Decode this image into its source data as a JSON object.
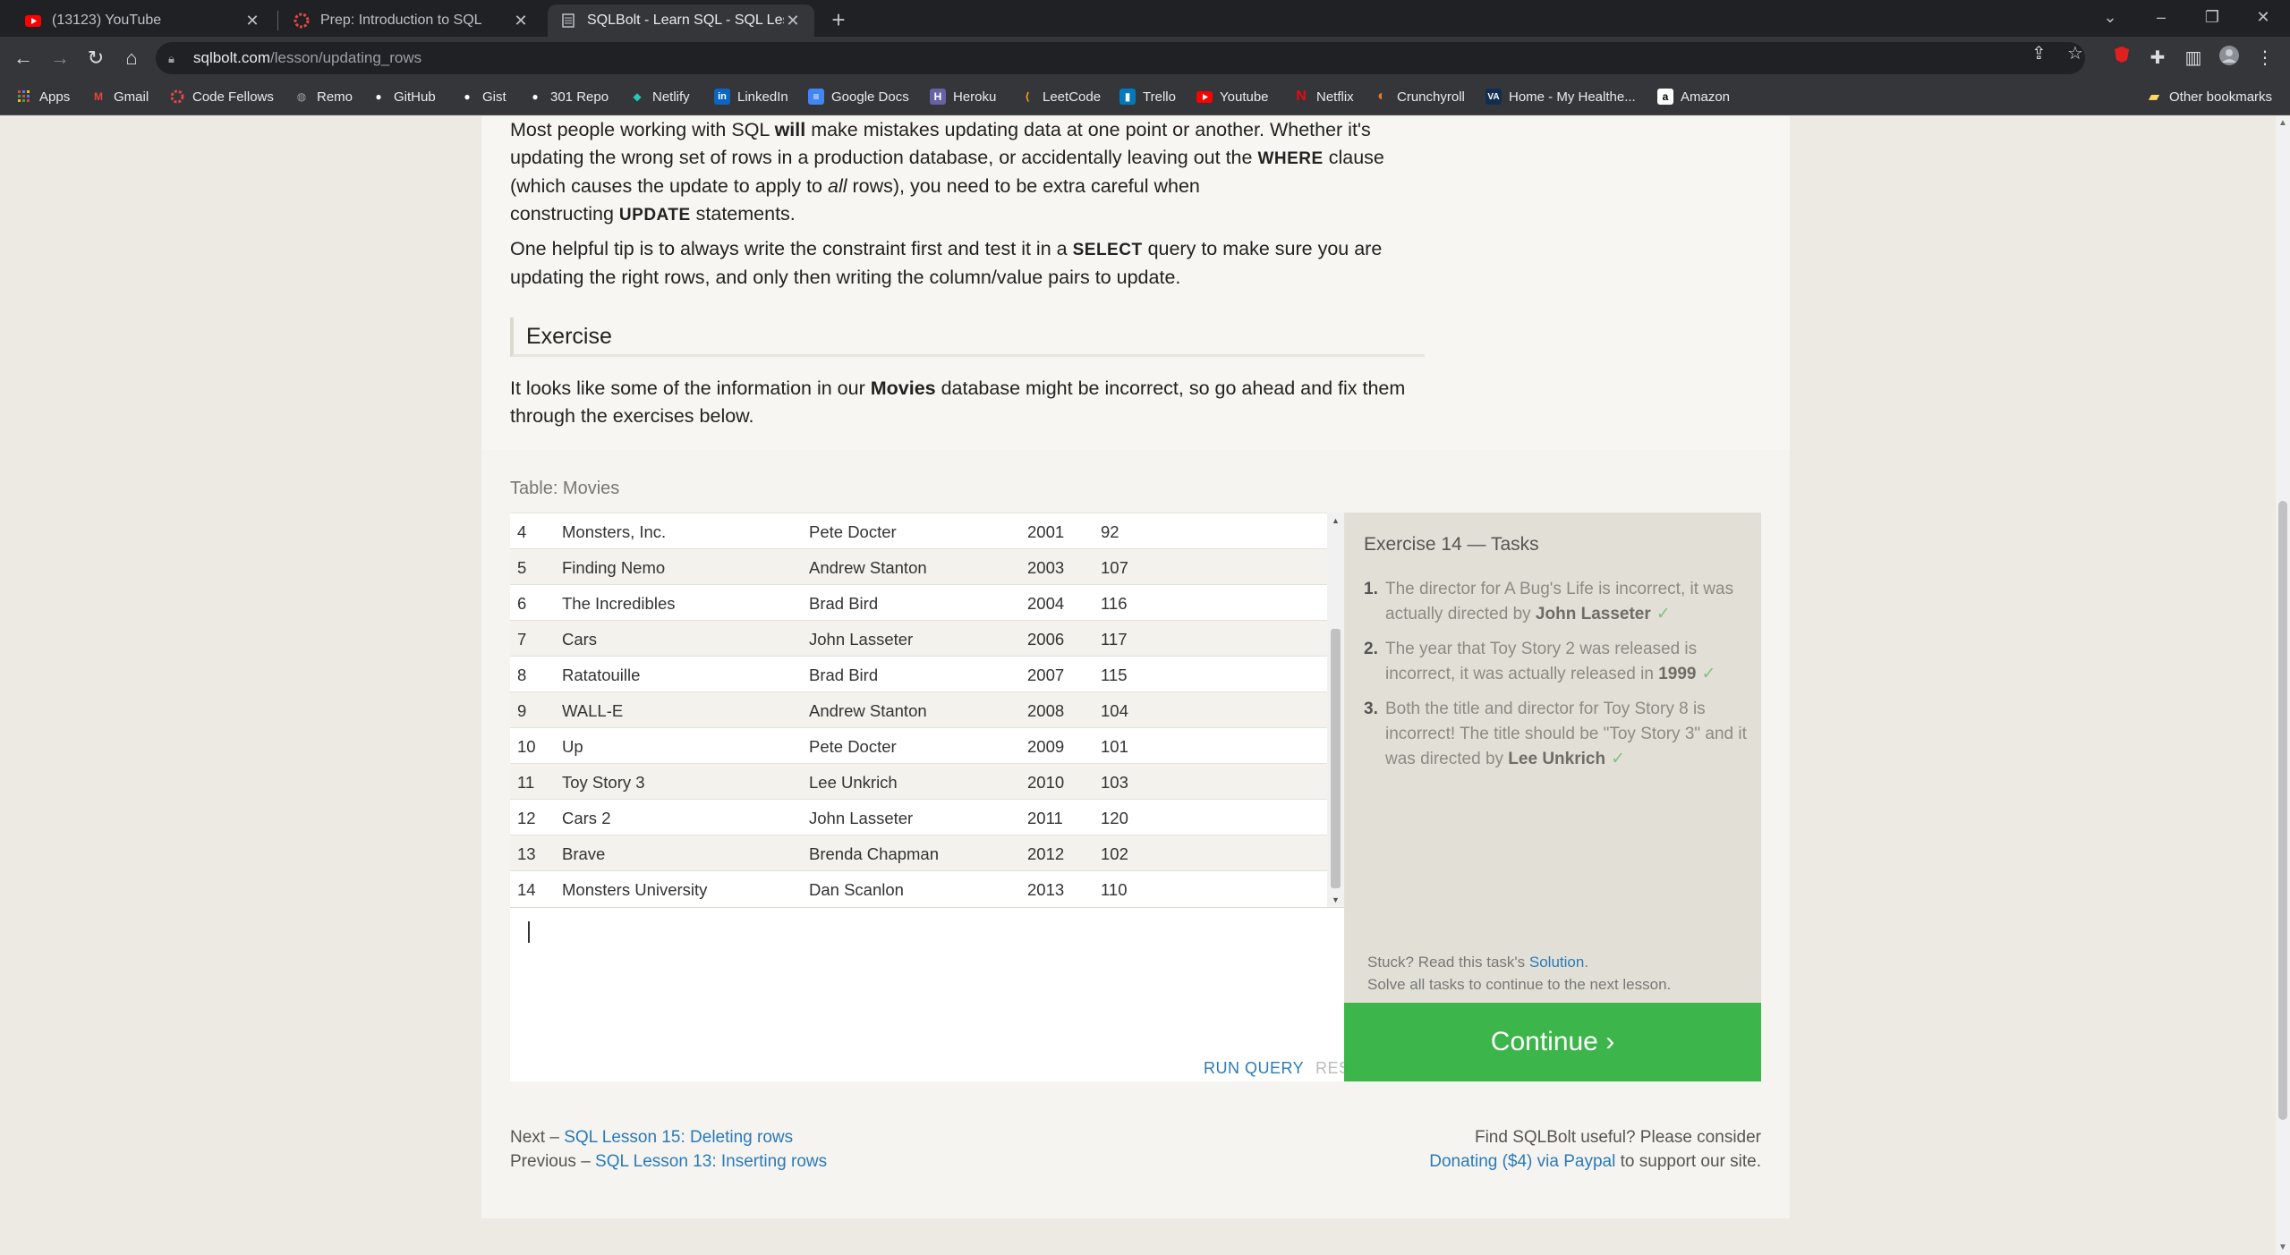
{
  "browser": {
    "tabs": [
      {
        "title": "(13123) YouTube",
        "icon": "youtube-icon",
        "active": false
      },
      {
        "title": "Prep: Introduction to SQL",
        "icon": "code-fellows-icon",
        "active": false
      },
      {
        "title": "SQLBolt - Learn SQL - SQL Lesso",
        "icon": "sqlbolt-icon",
        "active": true
      }
    ],
    "url_host": "sqlbolt.com",
    "url_path": "/lesson/updating_rows",
    "bookmarks": [
      {
        "label": "Apps",
        "icon": "apps-grid-icon"
      },
      {
        "label": "Gmail",
        "icon": "gmail-icon"
      },
      {
        "label": "Code Fellows",
        "icon": "code-fellows-icon"
      },
      {
        "label": "Remo",
        "icon": "remo-icon"
      },
      {
        "label": "GitHub",
        "icon": "github-icon"
      },
      {
        "label": "Gist",
        "icon": "github-icon"
      },
      {
        "label": "301 Repo",
        "icon": "github-icon"
      },
      {
        "label": "Netlify",
        "icon": "netlify-icon"
      },
      {
        "label": "LinkedIn",
        "icon": "linkedin-icon"
      },
      {
        "label": "Google Docs",
        "icon": "google-docs-icon"
      },
      {
        "label": "Heroku",
        "icon": "heroku-icon"
      },
      {
        "label": "LeetCode",
        "icon": "leetcode-icon"
      },
      {
        "label": "Trello",
        "icon": "trello-icon"
      },
      {
        "label": "Youtube",
        "icon": "youtube-icon"
      },
      {
        "label": "Netflix",
        "icon": "netflix-icon"
      },
      {
        "label": "Crunchyroll",
        "icon": "crunchyroll-icon"
      },
      {
        "label": "Home - My Healthe...",
        "icon": "va-icon"
      },
      {
        "label": "Amazon",
        "icon": "amazon-icon"
      }
    ],
    "other_bookmarks": "Other bookmarks"
  },
  "lesson": {
    "p1": {
      "a": "Most people working with SQL ",
      "b": "will",
      "c": " make mistakes updating data at one point or another. Whether it's updating the wrong set of rows in a production database, or accidentally leaving out the",
      "kw1": "WHERE",
      "d": "clause (which causes the update to apply to ",
      "e": "all",
      "f": " rows), you need to be extra careful when constructing",
      "kw2": "UPDATE",
      "g": "statements."
    },
    "p2": {
      "a": "One helpful tip is to always write the constraint first and test it in a",
      "kw": "SELECT",
      "b": "query to make sure you are updating the right rows, and only then writing the column/value pairs to update."
    },
    "exercise_heading": "Exercise",
    "p3": {
      "a": "It looks like some of the information in our ",
      "b": "Movies",
      "c": " database might be incorrect, so go ahead and fix them through the exercises below."
    }
  },
  "table": {
    "label": "Table: Movies",
    "rows": [
      {
        "id": "4",
        "title": "Monsters, Inc.",
        "director": "Pete Docter",
        "year": "2001",
        "length": "92"
      },
      {
        "id": "5",
        "title": "Finding Nemo",
        "director": "Andrew Stanton",
        "year": "2003",
        "length": "107"
      },
      {
        "id": "6",
        "title": "The Incredibles",
        "director": "Brad Bird",
        "year": "2004",
        "length": "116"
      },
      {
        "id": "7",
        "title": "Cars",
        "director": "John Lasseter",
        "year": "2006",
        "length": "117"
      },
      {
        "id": "8",
        "title": "Ratatouille",
        "director": "Brad Bird",
        "year": "2007",
        "length": "115"
      },
      {
        "id": "9",
        "title": "WALL-E",
        "director": "Andrew Stanton",
        "year": "2008",
        "length": "104"
      },
      {
        "id": "10",
        "title": "Up",
        "director": "Pete Docter",
        "year": "2009",
        "length": "101"
      },
      {
        "id": "11",
        "title": "Toy Story 3",
        "director": "Lee Unkrich",
        "year": "2010",
        "length": "103"
      },
      {
        "id": "12",
        "title": "Cars 2",
        "director": "John Lasseter",
        "year": "2011",
        "length": "120"
      },
      {
        "id": "13",
        "title": "Brave",
        "director": "Brenda Chapman",
        "year": "2012",
        "length": "102"
      },
      {
        "id": "14",
        "title": "Monsters University",
        "director": "Dan Scanlon",
        "year": "2013",
        "length": "110"
      }
    ]
  },
  "editor": {
    "query": "",
    "run_label": "RUN QUERY",
    "reset_label": "RESET"
  },
  "tasks": {
    "title": "Exercise 14 — Tasks",
    "items": [
      {
        "num": "1.",
        "a": "The director for A Bug's Life is incorrect, it was actually directed by ",
        "b": "John Lasseter",
        "check": "✓"
      },
      {
        "num": "2.",
        "a": "The year that Toy Story 2 was released is incorrect, it was actually released in ",
        "b": "1999",
        "check": "✓"
      },
      {
        "num": "3.",
        "a": "Both the title and director for Toy Story 8 is incorrect! The title should be \"Toy Story 3\" and it was directed by ",
        "b": "Lee Unkrich",
        "check": "✓"
      }
    ],
    "stuck_a": "Stuck? Read this task's ",
    "stuck_link": "Solution",
    "stuck_b": ".",
    "solve_all": "Solve all tasks to continue to the next lesson.",
    "continue_label": "Continue ›",
    "continue_color": "#3cb54a"
  },
  "footer": {
    "next_prefix": "Next – ",
    "next_link": "SQL Lesson 15: Deleting rows",
    "prev_prefix": "Previous – ",
    "prev_link": "SQL Lesson 13: Inserting rows",
    "support_a": "Find SQLBolt useful? Please consider",
    "support_link": "Donating ($4) via Paypal",
    "support_b": " to support our site."
  }
}
